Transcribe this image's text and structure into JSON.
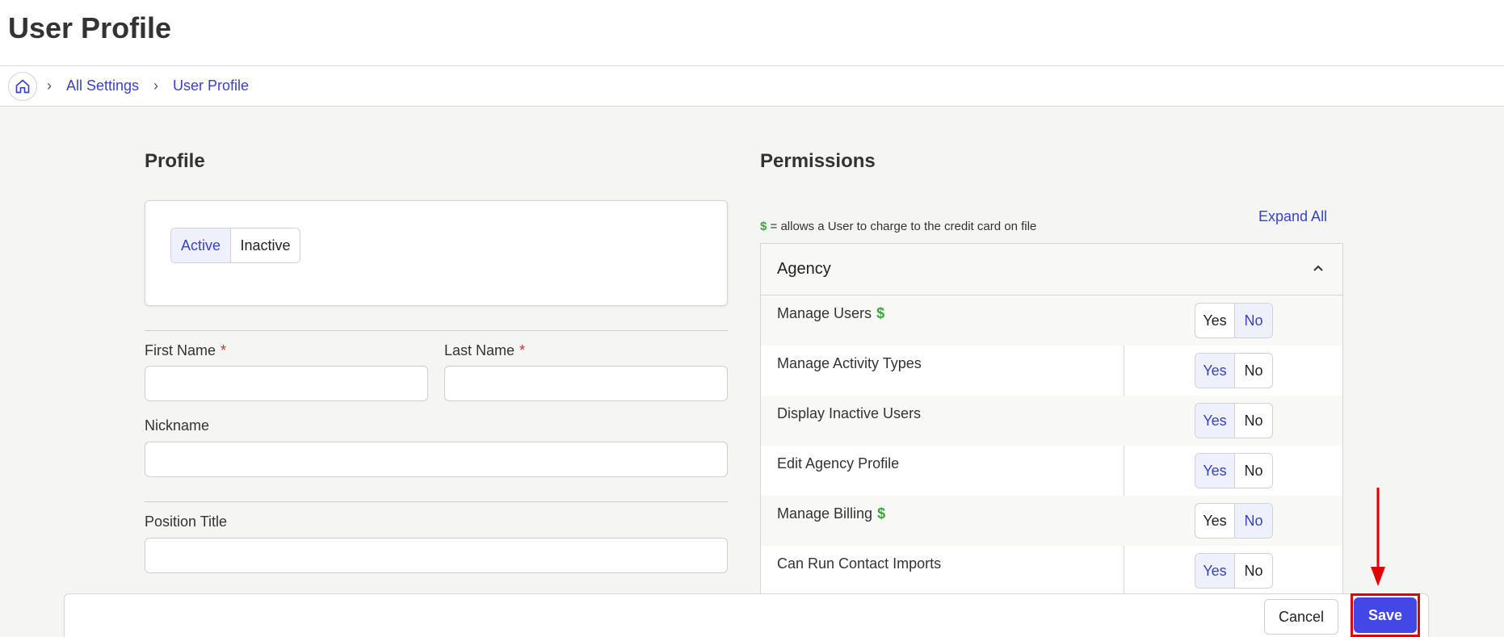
{
  "page": {
    "title": "User Profile"
  },
  "breadcrumb": {
    "items": [
      "All Settings",
      "User Profile"
    ]
  },
  "profile": {
    "heading": "Profile",
    "status": {
      "options": [
        "Active",
        "Inactive"
      ],
      "selected": "Active"
    },
    "fields": {
      "first_name": {
        "label": "First Name",
        "required_mark": "*",
        "value": ""
      },
      "last_name": {
        "label": "Last Name",
        "required_mark": "*",
        "value": ""
      },
      "nickname": {
        "label": "Nickname",
        "value": ""
      },
      "position_title": {
        "label": "Position Title",
        "value": ""
      }
    }
  },
  "permissions": {
    "heading": "Permissions",
    "legend_symbol": "$",
    "legend_text": "= allows a User to charge to the credit card on file",
    "expand_all": "Expand All",
    "group": {
      "title": "Agency",
      "rows": [
        {
          "label": "Manage Users",
          "dollar": "$",
          "yes": "Yes",
          "no": "No",
          "selected": "No"
        },
        {
          "label": "Manage Activity Types",
          "dollar": "",
          "yes": "Yes",
          "no": "No",
          "selected": "Yes"
        },
        {
          "label": "Display Inactive Users",
          "dollar": "",
          "yes": "Yes",
          "no": "No",
          "selected": "Yes"
        },
        {
          "label": "Edit Agency Profile",
          "dollar": "",
          "yes": "Yes",
          "no": "No",
          "selected": "Yes"
        },
        {
          "label": "Manage Billing",
          "dollar": "$",
          "yes": "Yes",
          "no": "No",
          "selected": "No"
        },
        {
          "label": "Can Run Contact Imports",
          "dollar": "",
          "yes": "Yes",
          "no": "No",
          "selected": "Yes"
        }
      ]
    }
  },
  "footer": {
    "cancel_label": "Cancel",
    "save_label": "Save"
  },
  "colors": {
    "accent": "#4347e6",
    "link": "#3b3fc4",
    "dollar": "#3aa53a",
    "highlight": "#e00000"
  }
}
